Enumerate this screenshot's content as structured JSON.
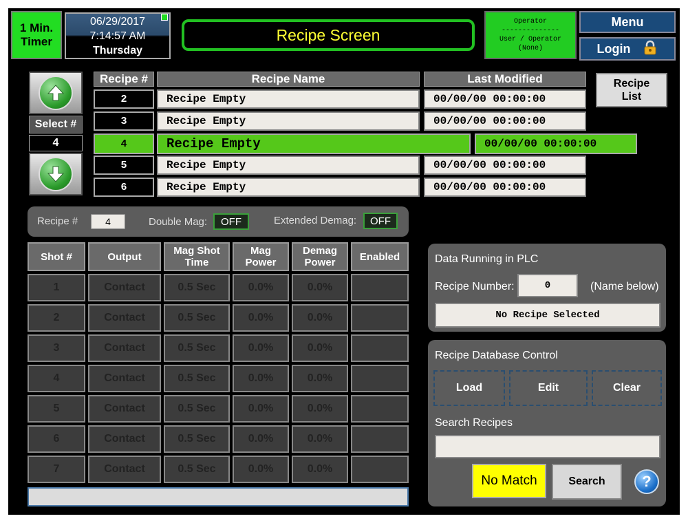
{
  "header": {
    "timer_line1": "1 Min.",
    "timer_line2": "Timer",
    "date": "06/29/2017",
    "time": "7:14:57 AM",
    "day": "Thursday",
    "title": "Recipe Screen",
    "operator_line1": "Operator",
    "operator_line2": "--------------",
    "operator_line3": "User / Operator",
    "operator_line4": "(None)",
    "menu_label": "Menu",
    "login_label": "Login"
  },
  "recipe_list": {
    "select_label": "Select #",
    "select_value": "4",
    "col_num": "Recipe #",
    "col_name": "Recipe Name",
    "col_modified": "Last Modified",
    "list_btn_line1": "Recipe",
    "list_btn_line2": "List",
    "rows": [
      {
        "num": "2",
        "name": "Recipe Empty",
        "modified": "00/00/00 00:00:00"
      },
      {
        "num": "3",
        "name": "Recipe Empty",
        "modified": "00/00/00 00:00:00"
      },
      {
        "num": "4",
        "name": "Recipe Empty",
        "modified": "00/00/00 00:00:00"
      },
      {
        "num": "5",
        "name": "Recipe Empty",
        "modified": "00/00/00 00:00:00"
      },
      {
        "num": "6",
        "name": "Recipe Empty",
        "modified": "00/00/00 00:00:00"
      }
    ]
  },
  "options": {
    "recipe_label": "Recipe #",
    "recipe_value": "4",
    "double_mag_label": "Double Mag:",
    "double_mag_value": "OFF",
    "ext_demag_label": "Extended Demag:",
    "ext_demag_value": "OFF"
  },
  "shots": {
    "headers": {
      "shot": "Shot #",
      "output": "Output",
      "mag_time_1": "Mag Shot",
      "mag_time_2": "Time",
      "mag_power_1": "Mag",
      "mag_power_2": "Power",
      "demag_power_1": "Demag",
      "demag_power_2": "Power",
      "enabled": "Enabled"
    },
    "rows": [
      {
        "shot": "1",
        "output": "Contact",
        "mag_time": "0.5 Sec",
        "mag_power": "0.0%",
        "demag_power": "0.0%",
        "enabled": ""
      },
      {
        "shot": "2",
        "output": "Contact",
        "mag_time": "0.5 Sec",
        "mag_power": "0.0%",
        "demag_power": "0.0%",
        "enabled": ""
      },
      {
        "shot": "3",
        "output": "Contact",
        "mag_time": "0.5 Sec",
        "mag_power": "0.0%",
        "demag_power": "0.0%",
        "enabled": ""
      },
      {
        "shot": "4",
        "output": "Contact",
        "mag_time": "0.5 Sec",
        "mag_power": "0.0%",
        "demag_power": "0.0%",
        "enabled": ""
      },
      {
        "shot": "5",
        "output": "Contact",
        "mag_time": "0.5 Sec",
        "mag_power": "0.0%",
        "demag_power": "0.0%",
        "enabled": ""
      },
      {
        "shot": "6",
        "output": "Contact",
        "mag_time": "0.5 Sec",
        "mag_power": "0.0%",
        "demag_power": "0.0%",
        "enabled": ""
      },
      {
        "shot": "7",
        "output": "Contact",
        "mag_time": "0.5 Sec",
        "mag_power": "0.0%",
        "demag_power": "0.0%",
        "enabled": ""
      }
    ]
  },
  "plc": {
    "title": "Data Running in PLC",
    "recipe_label": "Recipe Number:",
    "recipe_value": "0",
    "name_hint": "(Name below)",
    "recipe_name": "No Recipe Selected"
  },
  "db": {
    "title": "Recipe Database Control",
    "load": "Load",
    "edit": "Edit",
    "clear": "Clear",
    "search_label": "Search Recipes",
    "search_value": "",
    "match_status": "No Match",
    "search_btn": "Search",
    "help": "?"
  },
  "colors": {
    "accent_green": "#22dd22",
    "selected_row": "#55c81a",
    "title_text": "#ffff33",
    "nav_blue": "#1a4a7a",
    "no_match_bg": "#ffff00"
  },
  "icons": [
    "up-arrow-icon",
    "down-arrow-icon",
    "lock-icon",
    "help-icon"
  ]
}
